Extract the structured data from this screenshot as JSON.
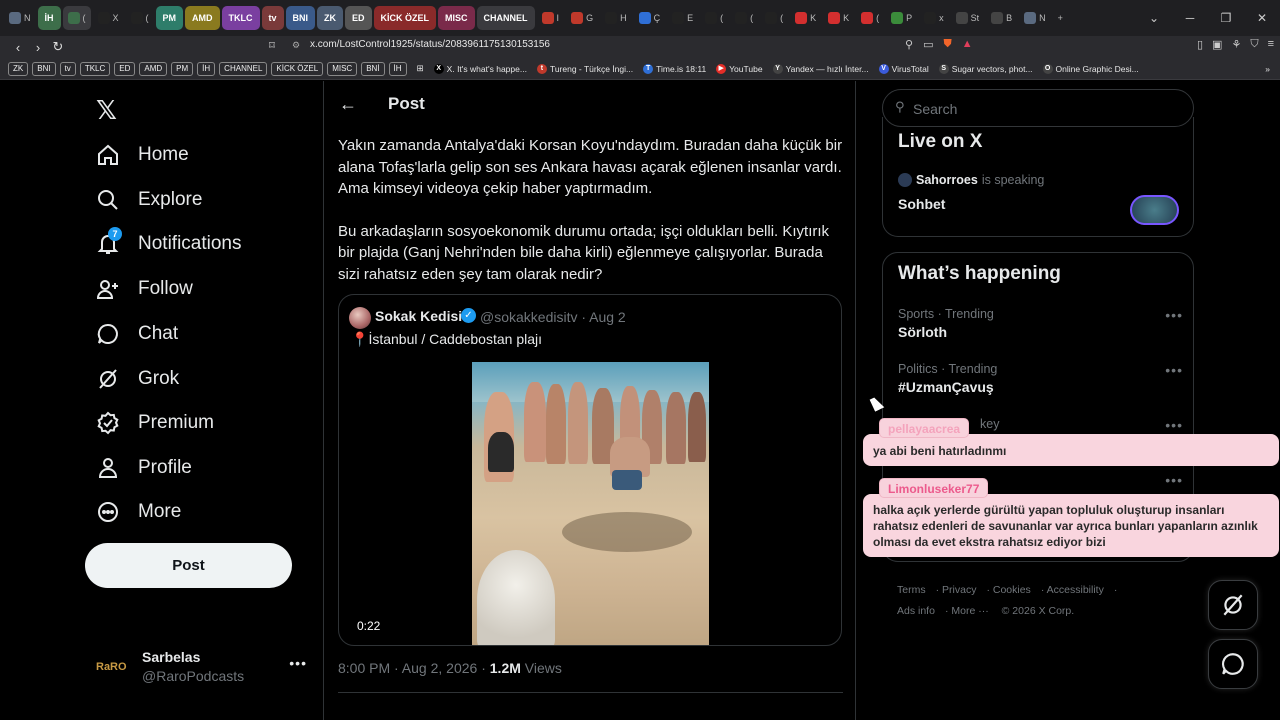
{
  "browser": {
    "tabs": [
      {
        "label": "N",
        "color": "#5a6a80",
        "group": false
      },
      {
        "label": "İH",
        "color": "#3d6e4a",
        "group": true
      },
      {
        "label": "(",
        "color": "#3d6e4a",
        "group": false,
        "active": true
      },
      {
        "label": "X",
        "color": "#222",
        "group": false
      },
      {
        "label": "(",
        "color": "#222",
        "group": false
      },
      {
        "label": "PM",
        "color": "#2e7d6a",
        "group": true
      },
      {
        "label": "AMD",
        "color": "#8a7a1f",
        "group": true
      },
      {
        "label": "TKLC",
        "color": "#7a3fa0",
        "group": true
      },
      {
        "label": "tv",
        "color": "#7a3a3a",
        "group": true
      },
      {
        "label": "BNI",
        "color": "#3a5a8a",
        "group": true
      },
      {
        "label": "ZK",
        "color": "#4a5a70",
        "group": true
      },
      {
        "label": "ED",
        "color": "#555",
        "group": true
      },
      {
        "label": "KİCK ÖZEL",
        "color": "#8a2a2a",
        "group": true
      },
      {
        "label": "MISC",
        "color": "#7a2a4a",
        "group": true
      },
      {
        "label": "CHANNEL",
        "color": "#3a3a3e",
        "group": true
      },
      {
        "label": "I",
        "color": "#c0392b",
        "group": false
      },
      {
        "label": "G",
        "color": "#c0392b",
        "group": false
      },
      {
        "label": "H",
        "color": "#222",
        "group": false
      },
      {
        "label": "Ç",
        "color": "#2f6fd6",
        "group": false
      },
      {
        "label": "E",
        "color": "#222",
        "group": false
      },
      {
        "label": "(",
        "color": "#222",
        "group": false
      },
      {
        "label": "(",
        "color": "#222",
        "group": false
      },
      {
        "label": "(",
        "color": "#222",
        "group": false
      },
      {
        "label": "K",
        "color": "#d32f2f",
        "group": false
      },
      {
        "label": "K",
        "color": "#d32f2f",
        "group": false
      },
      {
        "label": "(",
        "color": "#d32f2f",
        "group": false
      },
      {
        "label": "P",
        "color": "#3b8c3b",
        "group": false
      },
      {
        "label": "x",
        "color": "#222",
        "group": false
      },
      {
        "label": "St",
        "color": "#444",
        "group": false
      },
      {
        "label": "B",
        "color": "#444",
        "group": false
      },
      {
        "label": "N",
        "color": "#5a6a80",
        "group": false
      }
    ],
    "url": "x.com/LostControl1925/status/2083961175130153156",
    "bookmark_folders": [
      "ZK",
      "BNI",
      "tv",
      "TKLC",
      "ED",
      "AMD",
      "PM",
      "İH",
      "CHANNEL",
      "KİCK ÖZEL",
      "MISC",
      "BNİ",
      "İH"
    ],
    "bookmarks": [
      {
        "label": "X. It's what's happe...",
        "icon": "X",
        "color": "#000"
      },
      {
        "label": "Tureng - Türkçe İngi...",
        "icon": "t",
        "color": "#c0392b"
      },
      {
        "label": "Time.is 18:11",
        "icon": "T",
        "color": "#2f6fd6"
      },
      {
        "label": "YouTube",
        "icon": "▶",
        "color": "#e52d27"
      },
      {
        "label": "Yandex — hızlı İnter...",
        "icon": "Y",
        "color": "#444"
      },
      {
        "label": "VirusTotal",
        "icon": "V",
        "color": "#3b5bdb"
      },
      {
        "label": "Sugar vectors, phot...",
        "icon": "S",
        "color": "#444"
      },
      {
        "label": "Online Graphic Desi...",
        "icon": "O",
        "color": "#444"
      }
    ]
  },
  "nav": {
    "items": [
      {
        "label": "Home",
        "icon": "home-icon"
      },
      {
        "label": "Explore",
        "icon": "search-icon"
      },
      {
        "label": "Notifications",
        "icon": "bell-icon",
        "badge": "7"
      },
      {
        "label": "Follow",
        "icon": "follow-icon"
      },
      {
        "label": "Chat",
        "icon": "chat-icon"
      },
      {
        "label": "Grok",
        "icon": "grok-icon"
      },
      {
        "label": "Premium",
        "icon": "premium-icon"
      },
      {
        "label": "Profile",
        "icon": "profile-icon"
      },
      {
        "label": "More",
        "icon": "more-icon"
      }
    ],
    "post_button": "Post",
    "account": {
      "avatar_text": "RaRO",
      "name": "Sarbelas",
      "handle": "@RaroPodcasts"
    }
  },
  "post": {
    "header_title": "Post",
    "paragraphs": [
      "Yakın zamanda Antalya'daki Korsan Koyu'ndaydım. Buradan daha küçük bir alana Tofaş'larla gelip son ses Ankara havası açarak eğlenen insanlar vardı. Ama kimseyi videoya çekip haber yaptırmadım.",
      "Bu arkadaşların sosyoekonomik durumu ortada; işçi oldukları belli. Kıytırık bir plajda (Ganj Nehri'nden bile daha kirli) eğlenmeye çalışıyorlar. Burada sizi rahatsız eden şey tam olarak nedir?"
    ],
    "quote": {
      "name": "Sokak Kedisi",
      "handle": "@sokakkedisitv · Aug 2",
      "text": "İstanbul / Caddebostan plajı",
      "video_time": "0:22"
    },
    "meta_time": "8:00 PM · Aug 2, 2026 · ",
    "meta_views": "1.2M",
    "meta_views_label": " Views"
  },
  "right": {
    "search_placeholder": "Search",
    "live": {
      "title": "Live on X",
      "speaker": "Sahorroes",
      "speaking_label": " is speaking",
      "space_title": "Sohbet"
    },
    "happening": {
      "title": "What’s happening",
      "trends": [
        {
          "category": "Sports · Trending",
          "name": "Sörloth"
        },
        {
          "category": "Politics · Trending",
          "name": "#UzmanÇavuş"
        },
        {
          "category": "key",
          "name": ""
        },
        {
          "category": "",
          "name": ""
        }
      ]
    },
    "footer": [
      "Terms",
      "Privacy",
      "Cookies",
      "Accessibility",
      "Ads info",
      "More ···",
      "© 2026 X Corp."
    ]
  },
  "chat_overlay": [
    {
      "user": "pellayaacrea",
      "message": "ya abi beni hatırladınmı"
    },
    {
      "user": "Limonluseker77",
      "message": "halka açık yerlerde gürültü yapan topluluk oluşturup insanları rahatsız edenleri de savunanlar var ayrıca bunları yapanların azınlık olması da evet ekstra rahatsız ediyor bizi"
    }
  ],
  "colors": {
    "accent": "#1d9bf0",
    "chat_bg": "#f9d5de",
    "chat_user": "#ec5a8c",
    "premium_purple": "#7856ff"
  }
}
